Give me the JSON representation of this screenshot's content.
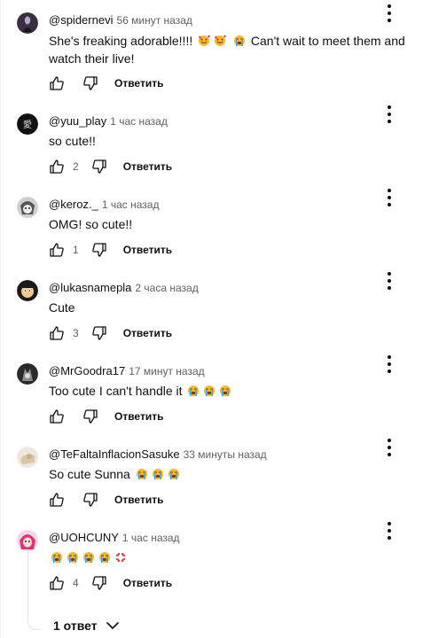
{
  "comments": [
    {
      "author": "@spidernevi",
      "time": "56 минут назад",
      "text_parts": [
        "She's freaking adorable!!!! ",
        " Can't wait to meet them and watch their live!"
      ],
      "emojis": [
        "smiling-face-with-hearts",
        "smiling-face-with-hearts",
        "loudly-crying-face"
      ],
      "likes": "",
      "reply_label": "Ответить",
      "avatar_icon": "silhouette-avatar"
    },
    {
      "author": "@yuu_play",
      "time": "1 час назад",
      "text": "so cute!!",
      "likes": "2",
      "reply_label": "Ответить",
      "avatar_icon": "kanji-avatar"
    },
    {
      "author": "@keroz._",
      "time": "1 час назад",
      "text": "OMG! so cute!!",
      "likes": "1",
      "reply_label": "Ответить",
      "avatar_icon": "manga-avatar"
    },
    {
      "author": "@lukasnamepla",
      "time": "2 часа назад",
      "text": "Cute",
      "likes": "3",
      "reply_label": "Ответить",
      "avatar_icon": "cartoon-avatar"
    },
    {
      "author": "@MrGoodra17",
      "time": "17 минут назад",
      "text": "Too cute I can't handle it",
      "emojis": [
        "loudly-crying-face",
        "loudly-crying-face",
        "loudly-crying-face"
      ],
      "likes": "",
      "reply_label": "Ответить",
      "avatar_icon": "dark-avatar"
    },
    {
      "author": "@TeFaltaInflacionSasuke",
      "time": "33 минуты назад",
      "text": "So cute Sunna",
      "emojis": [
        "loudly-crying-face",
        "loudly-crying-face",
        "loudly-crying-face"
      ],
      "likes": "",
      "reply_label": "Ответить",
      "avatar_icon": "sketch-avatar"
    },
    {
      "author": "@UOHCUNY",
      "time": "1 час назад",
      "text": "",
      "emojis": [
        "loudly-crying-face",
        "loudly-crying-face",
        "loudly-crying-face",
        "loudly-crying-face",
        "anger-symbol"
      ],
      "likes": "4",
      "reply_label": "Ответить",
      "avatar_icon": "pink-avatar"
    }
  ],
  "replies_toggle": {
    "label": "1 ответ",
    "icon": "chevron-down-icon"
  },
  "colors": {
    "text": "#0f0f0f",
    "secondary": "#606060",
    "thread_line": "#e5e5e5"
  }
}
